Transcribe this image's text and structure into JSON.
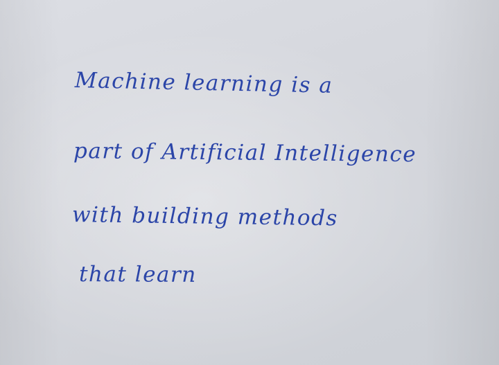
{
  "note": {
    "lines": [
      "Machine learning is a",
      "part of Artificial Intelligence",
      "with building methods",
      "that learn"
    ],
    "ink_color": "#2b45a8",
    "paper_color": "#d6d8de"
  }
}
